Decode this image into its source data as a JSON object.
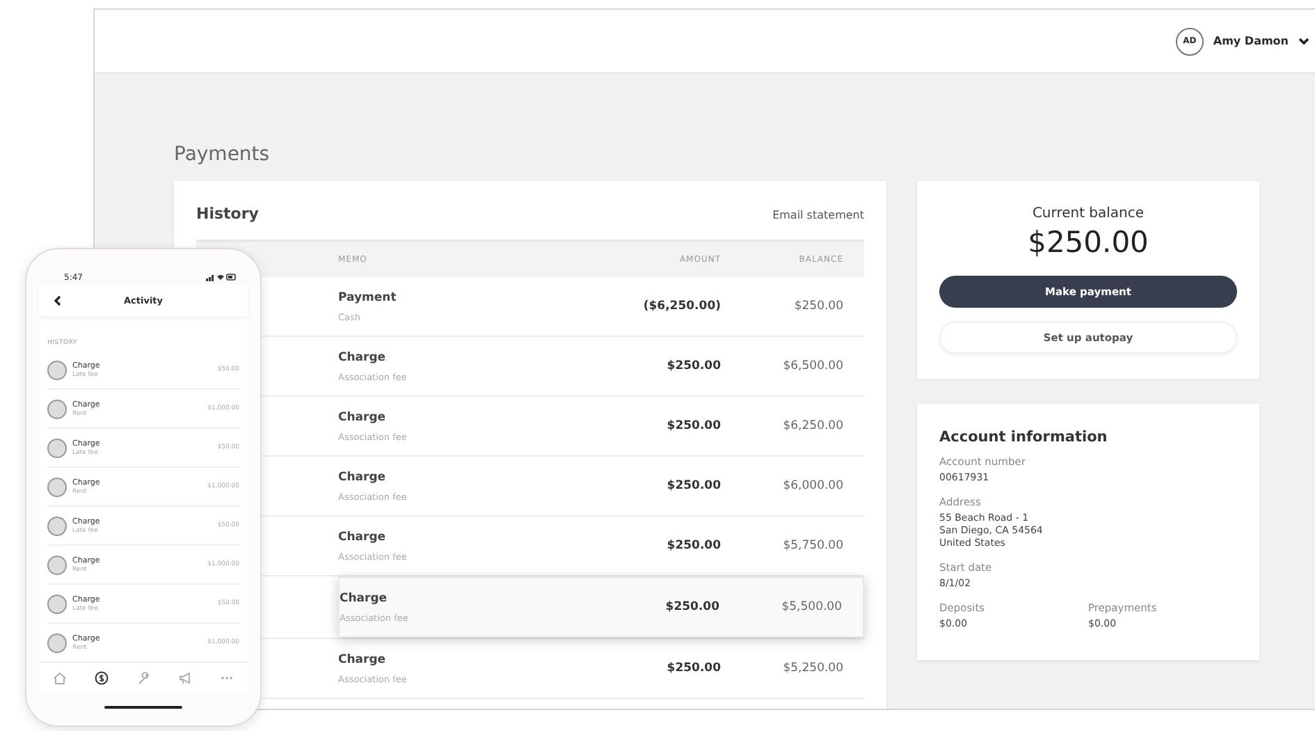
{
  "header": {
    "initials": "AD",
    "name": "Amy Damon"
  },
  "page_title": "Payments",
  "history": {
    "title": "History",
    "email_link": "Email statement",
    "columns": [
      "MEMO",
      "AMOUNT",
      "BALANCE"
    ],
    "rows": [
      {
        "type": "Payment",
        "memo": "Cash",
        "amount": "($6,250.00)",
        "balance": "$250.00",
        "hovered": false
      },
      {
        "type": "Charge",
        "memo": "Association fee",
        "amount": "$250.00",
        "balance": "$6,500.00",
        "hovered": false
      },
      {
        "type": "Charge",
        "memo": "Association fee",
        "amount": "$250.00",
        "balance": "$6,250.00",
        "hovered": false
      },
      {
        "type": "Charge",
        "memo": "Association fee",
        "amount": "$250.00",
        "balance": "$6,000.00",
        "hovered": false
      },
      {
        "type": "Charge",
        "memo": "Association fee",
        "amount": "$250.00",
        "balance": "$5,750.00",
        "hovered": false
      },
      {
        "type": "Charge",
        "memo": "Association fee",
        "amount": "$250.00",
        "balance": "$5,500.00",
        "hovered": true
      },
      {
        "type": "Charge",
        "memo": "Association fee",
        "amount": "$250.00",
        "balance": "$5,250.00",
        "hovered": false
      }
    ]
  },
  "balance": {
    "label": "Current balance",
    "amount": "$250.00",
    "buttons": [
      {
        "label": "Make payment",
        "kind": "primary"
      },
      {
        "label": "Set up autopay",
        "kind": "secondary"
      }
    ]
  },
  "account": {
    "title": "Account information",
    "fields": [
      {
        "label": "Account number",
        "lines": [
          "00617931"
        ]
      },
      {
        "label": "Address",
        "lines": [
          "55 Beach Road - 1",
          "San Diego, CA 54564",
          "United States"
        ]
      },
      {
        "label": "Start date",
        "lines": [
          "8/1/02"
        ]
      }
    ],
    "pairs": [
      {
        "label": "Deposits",
        "value": "$0.00"
      },
      {
        "label": "Prepayments",
        "value": "$0.00"
      }
    ]
  },
  "phone": {
    "time": "5:47",
    "title": "Activity",
    "section": "HISTORY",
    "rows": [
      {
        "type": "Charge",
        "memo": "Late fee",
        "amount": "$50.00"
      },
      {
        "type": "Charge",
        "memo": "Rent",
        "amount": "$1,000.00"
      },
      {
        "type": "Charge",
        "memo": "Late fee",
        "amount": "$50.00"
      },
      {
        "type": "Charge",
        "memo": "Rent",
        "amount": "$1,000.00"
      },
      {
        "type": "Charge",
        "memo": "Late fee",
        "amount": "$50.00"
      },
      {
        "type": "Charge",
        "memo": "Rent",
        "amount": "$1,000.00"
      },
      {
        "type": "Charge",
        "memo": "Late fee",
        "amount": "$50.00"
      },
      {
        "type": "Charge",
        "memo": "Rent",
        "amount": "$1,000.00"
      }
    ],
    "tabs": [
      {
        "kind": "home",
        "selected": false
      },
      {
        "kind": "payments",
        "selected": true
      },
      {
        "kind": "maintenance",
        "selected": false
      },
      {
        "kind": "announcements",
        "selected": false
      },
      {
        "kind": "more",
        "selected": false
      }
    ]
  }
}
